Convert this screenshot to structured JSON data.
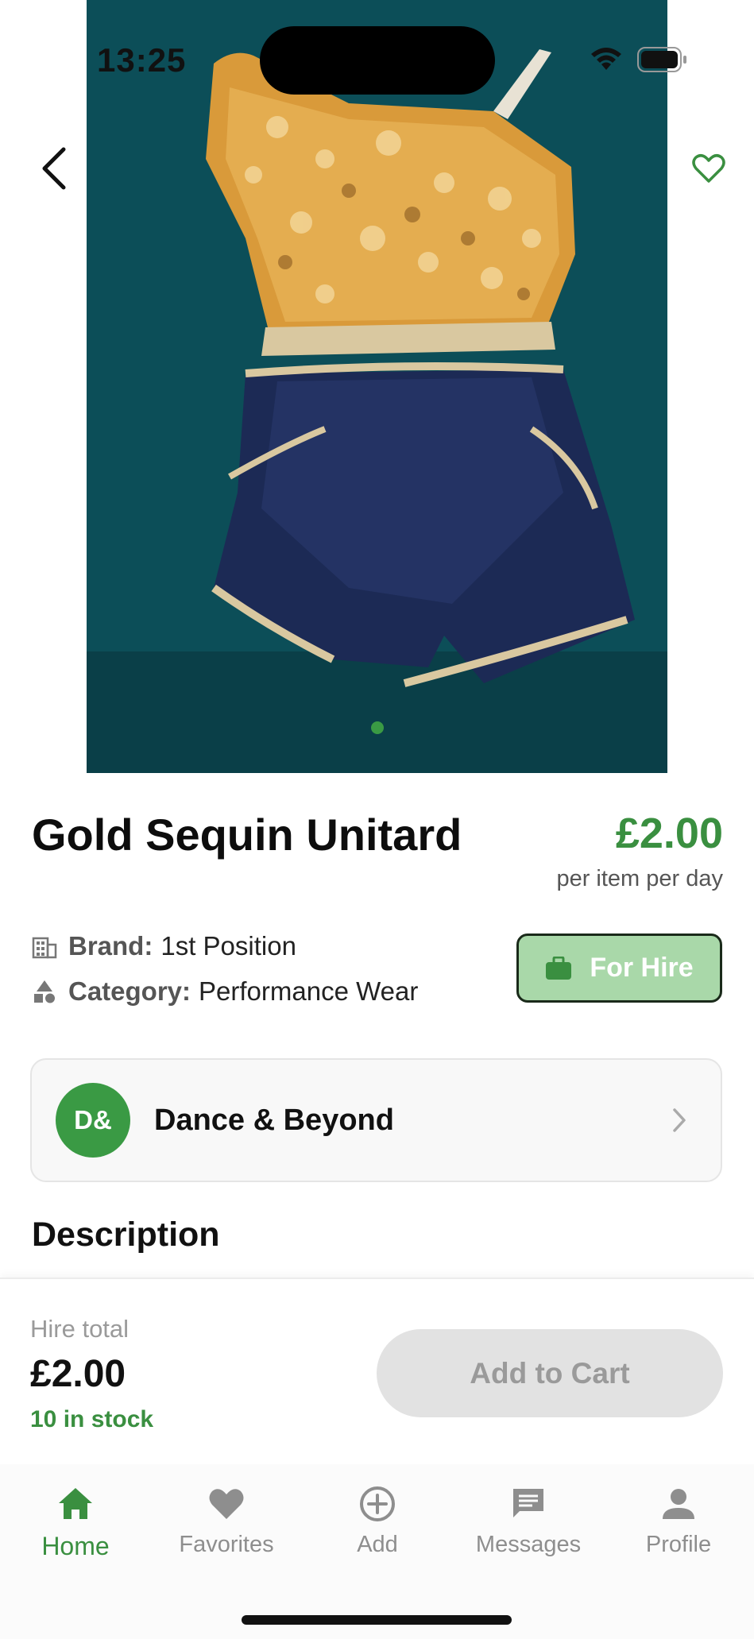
{
  "status_bar": {
    "time": "13:25"
  },
  "product": {
    "title": "Gold Sequin Unitard",
    "price": "£2.00",
    "price_unit": "per item per day",
    "brand_label": "Brand:",
    "brand": "1st Position",
    "category_label": "Category:",
    "category": "Performance Wear",
    "hire_badge": "For Hire",
    "image_count": 1,
    "active_image_index": 0
  },
  "seller": {
    "initials": "D&",
    "name": "Dance & Beyond"
  },
  "description": {
    "heading": "Description"
  },
  "checkout": {
    "hire_total_label": "Hire total",
    "hire_total": "£2.00",
    "stock": "10 in stock",
    "add_to_cart": "Add to Cart"
  },
  "tabs": [
    {
      "label": "Home",
      "icon": "home-icon",
      "active": true
    },
    {
      "label": "Favorites",
      "icon": "heart-icon",
      "active": false
    },
    {
      "label": "Add",
      "icon": "plus-circle-icon",
      "active": false
    },
    {
      "label": "Messages",
      "icon": "message-icon",
      "active": false
    },
    {
      "label": "Profile",
      "icon": "person-icon",
      "active": false
    }
  ],
  "colors": {
    "accent": "#3a8f40",
    "hire_badge_bg": "#a9d8a9",
    "disabled_button": "#e2e2e2"
  }
}
